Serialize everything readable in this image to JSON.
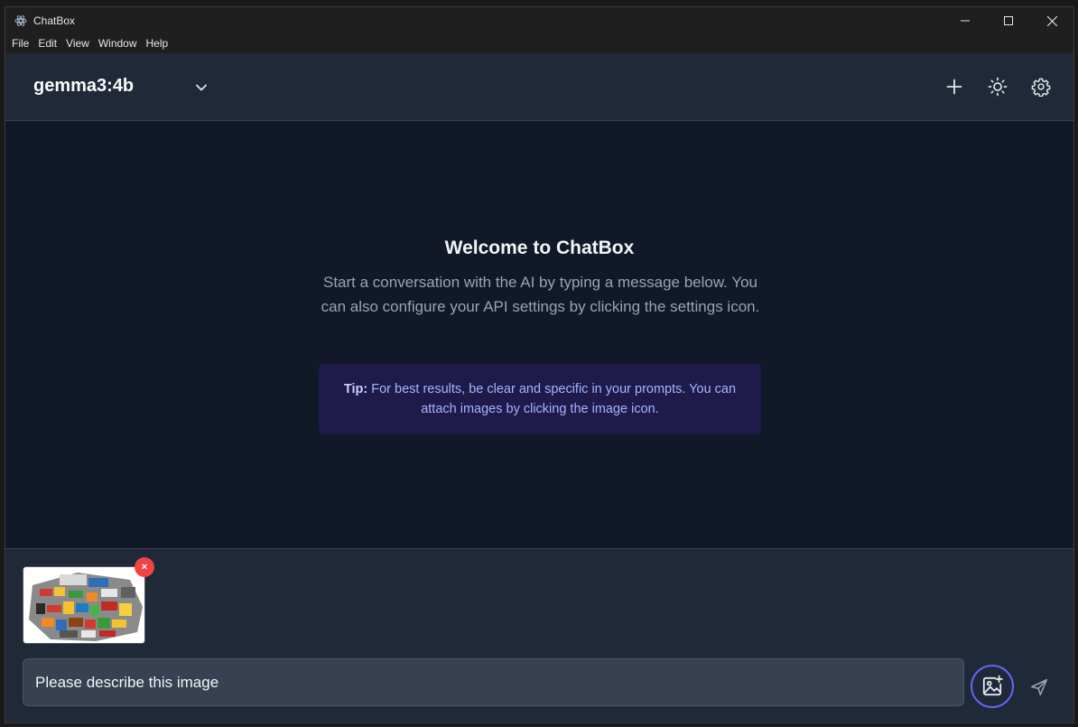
{
  "window": {
    "title": "ChatBox",
    "controls": [
      "minimize-icon",
      "maximize-icon",
      "close-icon"
    ]
  },
  "menu": {
    "items": [
      "File",
      "Edit",
      "View",
      "Window",
      "Help"
    ]
  },
  "header": {
    "model_name": "gemma3:4b",
    "icons": [
      "chevron-down-icon",
      "plus-icon",
      "sun-icon",
      "gear-icon"
    ]
  },
  "welcome": {
    "title": "Welcome to ChatBox",
    "text": "Start a conversation with the AI by typing a message below. You can also configure your API settings by clicking the settings icon.",
    "tip_label": "Tip:",
    "tip_text": " For best results, be clear and specific in your prompts. You can attach images by clicking the image icon."
  },
  "composer": {
    "remove_label": "×",
    "input_value": "Please describe this image",
    "icons": [
      "image-plus-icon",
      "send-icon"
    ]
  },
  "colors": {
    "background": "#111827",
    "header": "#1f2937",
    "accent": "#6366f1",
    "tip_bg": "#1e1b4b",
    "remove": "#ef4444"
  }
}
